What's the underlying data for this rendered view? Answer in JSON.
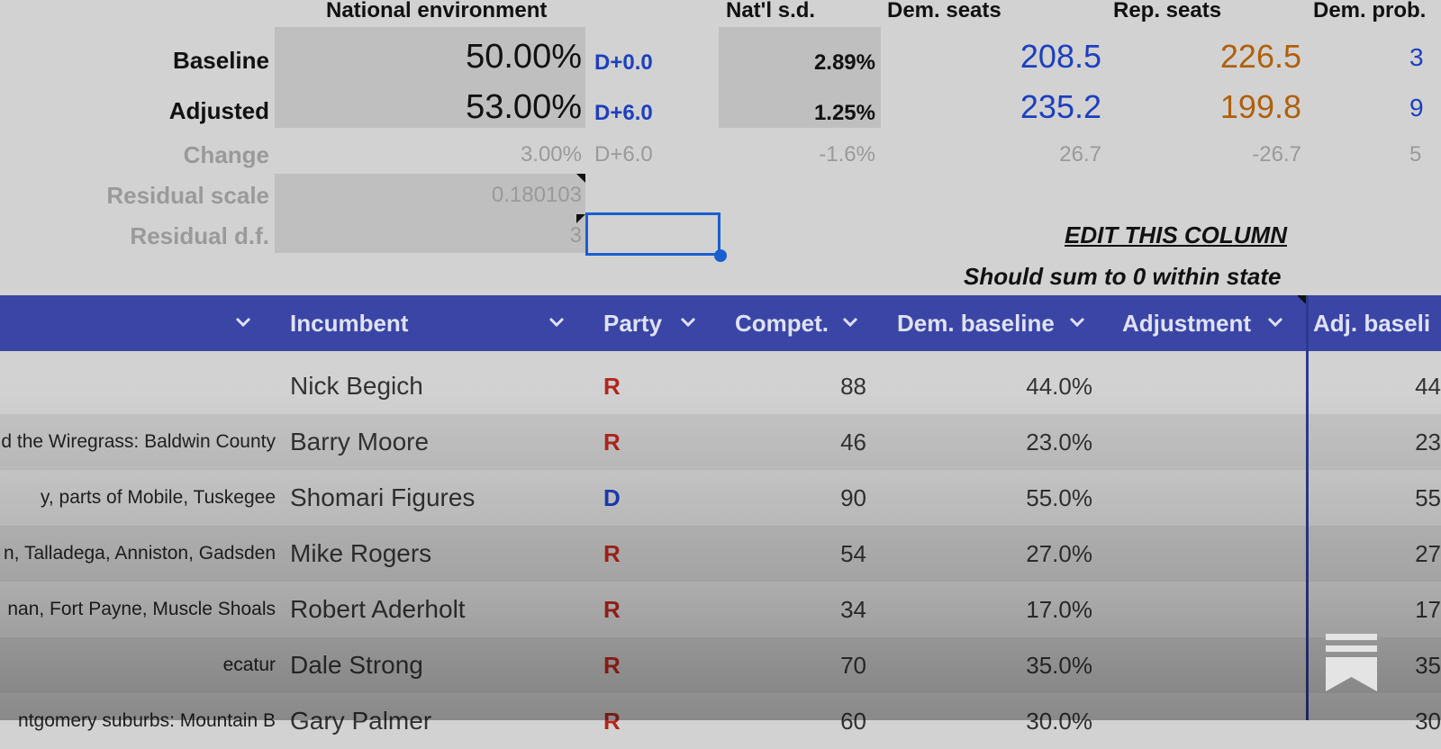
{
  "summary": {
    "headers": {
      "national_env": "National environment",
      "nat_sd": "Nat'l s.d.",
      "dem_seats": "Dem. seats",
      "rep_seats": "Rep. seats",
      "dem_prob": "Dem. prob."
    },
    "baseline": {
      "label": "Baseline",
      "env": "50.00%",
      "dmargin": "D+0.0",
      "sd": "2.89%",
      "dem_seats": "208.5",
      "rep_seats": "226.5",
      "dem_prob": "3"
    },
    "adjusted": {
      "label": "Adjusted",
      "env": "53.00%",
      "dmargin": "D+6.0",
      "sd": "1.25%",
      "dem_seats": "235.2",
      "rep_seats": "199.8",
      "dem_prob": "9"
    },
    "change": {
      "label": "Change",
      "env": "3.00%",
      "dmargin": "D+6.0",
      "sd": "-1.6%",
      "dem_seats": "26.7",
      "rep_seats": "-26.7",
      "dem_prob": "5"
    },
    "residual_scale": {
      "label": "Residual scale",
      "value": "0.180103"
    },
    "residual_df": {
      "label": "Residual d.f.",
      "value": "3"
    },
    "edit_note": "EDIT THIS COLUMN",
    "sum_note": "Should sum to 0 within state"
  },
  "table": {
    "columns": [
      "Incumbent",
      "Party",
      "Compet.",
      "Dem. baseline",
      "Adjustment",
      "Adj. baseli"
    ],
    "rows": [
      {
        "district": "",
        "incumbent": "Nick Begich",
        "party": "R",
        "compet": "88",
        "dem_baseline": "44.0%",
        "adjustment": "",
        "adj_baseline": "44"
      },
      {
        "district": "d the Wiregrass: Baldwin County",
        "incumbent": "Barry Moore",
        "party": "R",
        "compet": "46",
        "dem_baseline": "23.0%",
        "adjustment": "",
        "adj_baseline": "23"
      },
      {
        "district": "y, parts of Mobile, Tuskegee",
        "incumbent": "Shomari Figures",
        "party": "D",
        "compet": "90",
        "dem_baseline": "55.0%",
        "adjustment": "",
        "adj_baseline": "55"
      },
      {
        "district": "n, Talladega, Anniston, Gadsden",
        "incumbent": "Mike Rogers",
        "party": "R",
        "compet": "54",
        "dem_baseline": "27.0%",
        "adjustment": "",
        "adj_baseline": "27"
      },
      {
        "district": "nan, Fort Payne, Muscle Shoals",
        "incumbent": "Robert Aderholt",
        "party": "R",
        "compet": "34",
        "dem_baseline": "17.0%",
        "adjustment": "",
        "adj_baseline": "17"
      },
      {
        "district": "ecatur",
        "incumbent": "Dale Strong",
        "party": "R",
        "compet": "70",
        "dem_baseline": "35.0%",
        "adjustment": "",
        "adj_baseline": "35"
      },
      {
        "district": "ntgomery suburbs: Mountain B",
        "incumbent": "Gary Palmer",
        "party": "R",
        "compet": "60",
        "dem_baseline": "30.0%",
        "adjustment": "",
        "adj_baseline": "30"
      }
    ]
  },
  "colors": {
    "dem": "#1d3fbf",
    "rep": "#b0600c",
    "party_r": "#b3261e",
    "party_d": "#1d3fbf",
    "header_bar": "#3a45a6"
  },
  "icons": {
    "dropdown": "chevron-down-icon",
    "logo": "bookmark-logo-icon"
  }
}
